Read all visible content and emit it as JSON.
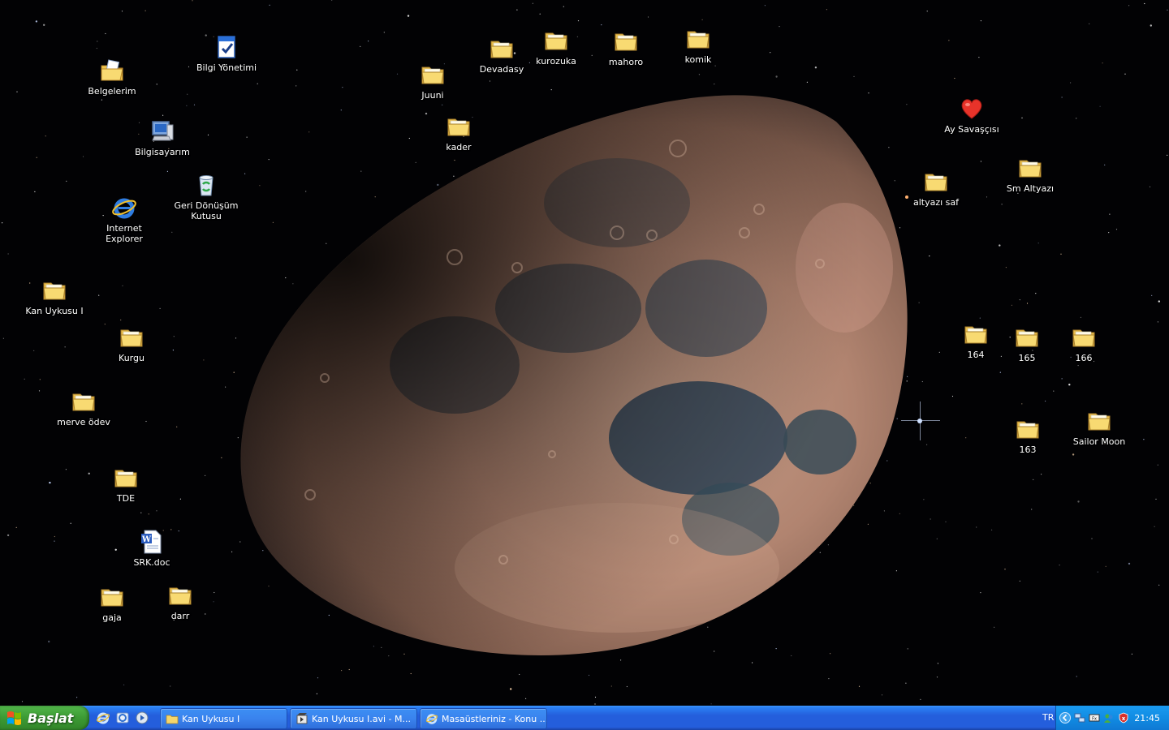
{
  "desktop": {
    "icons": [
      {
        "label": "Bilgi Yönetimi",
        "type": "doc-check"
      },
      {
        "label": "Belgelerim",
        "type": "my-docs"
      },
      {
        "label": "Bilgisayarım",
        "type": "computer"
      },
      {
        "label": "Geri Dönüşüm Kutusu",
        "type": "recycle"
      },
      {
        "label": "Internet Explorer",
        "type": "ie"
      },
      {
        "label": "Kan Uykusu I",
        "type": "folder"
      },
      {
        "label": "Kurgu",
        "type": "folder"
      },
      {
        "label": "merve ödev",
        "type": "folder"
      },
      {
        "label": "TDE",
        "type": "folder"
      },
      {
        "label": "SRK.doc",
        "type": "word"
      },
      {
        "label": "gaja",
        "type": "folder"
      },
      {
        "label": "darr",
        "type": "folder"
      },
      {
        "label": "Juuni",
        "type": "folder"
      },
      {
        "label": "Devadasy",
        "type": "folder"
      },
      {
        "label": "kurozuka",
        "type": "folder"
      },
      {
        "label": "mahoro",
        "type": "folder"
      },
      {
        "label": "komik",
        "type": "folder"
      },
      {
        "label": "kader",
        "type": "folder"
      },
      {
        "label": "Ay Savaşçısı",
        "type": "heart"
      },
      {
        "label": "altyazı saf",
        "type": "folder"
      },
      {
        "label": "Sm Altyazı",
        "type": "folder"
      },
      {
        "label": "164",
        "type": "folder"
      },
      {
        "label": "165",
        "type": "folder"
      },
      {
        "label": "166",
        "type": "folder"
      },
      {
        "label": "163",
        "type": "folder"
      },
      {
        "label": "Sailor Moon",
        "type": "folder"
      }
    ]
  },
  "taskbar": {
    "start_label": "Başlat",
    "quick_launch": [
      "ie-icon",
      "outlook-express-icon",
      "media-player-icon"
    ],
    "tasks": [
      {
        "label": "Kan Uykusu I",
        "icon": "folder-icon"
      },
      {
        "label": "Kan Uykusu I.avi - M...",
        "icon": "movie-icon"
      },
      {
        "label": "Masaüstleriniz - Konu ...",
        "icon": "ie-icon"
      }
    ],
    "tray": {
      "language": "TR",
      "clock": "21:45",
      "icons": [
        "chevron-left-icon",
        "network-icon",
        "keyboard-icon",
        "messenger-icon",
        "security-shield-icon"
      ]
    }
  },
  "colors": {
    "taskbar_blue": "#245edc",
    "start_green": "#3c9a34",
    "tray_blue": "#118ce3",
    "folder_yellow": "#f5d66b"
  }
}
